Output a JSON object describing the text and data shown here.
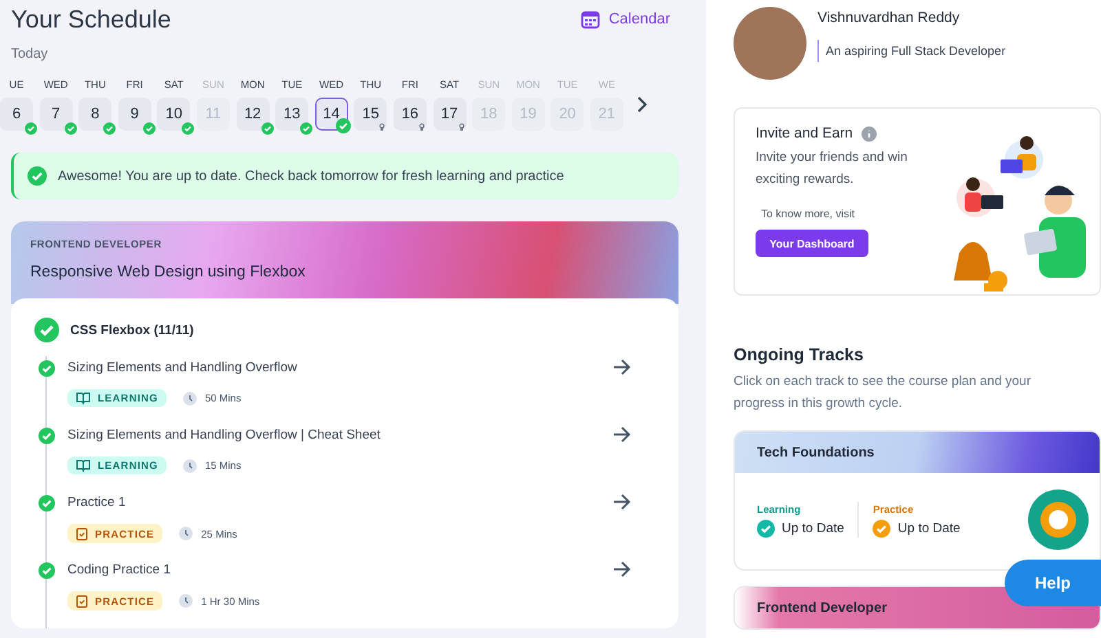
{
  "schedule": {
    "title": "Your Schedule",
    "calendar_link": "Calendar",
    "today_label": "Today",
    "days": [
      {
        "day": "UE",
        "date": "6",
        "completed": true,
        "locked": false,
        "disabled": false,
        "selected": false
      },
      {
        "day": "WED",
        "date": "7",
        "completed": true,
        "locked": false,
        "disabled": false,
        "selected": false
      },
      {
        "day": "THU",
        "date": "8",
        "completed": true,
        "locked": false,
        "disabled": false,
        "selected": false
      },
      {
        "day": "FRI",
        "date": "9",
        "completed": true,
        "locked": false,
        "disabled": false,
        "selected": false
      },
      {
        "day": "SAT",
        "date": "10",
        "completed": true,
        "locked": false,
        "disabled": false,
        "selected": false
      },
      {
        "day": "SUN",
        "date": "11",
        "completed": false,
        "locked": false,
        "disabled": true,
        "selected": false
      },
      {
        "day": "MON",
        "date": "12",
        "completed": true,
        "locked": false,
        "disabled": false,
        "selected": false
      },
      {
        "day": "TUE",
        "date": "13",
        "completed": true,
        "locked": false,
        "disabled": false,
        "selected": false
      },
      {
        "day": "WED",
        "date": "14",
        "completed": true,
        "locked": false,
        "disabled": false,
        "selected": true
      },
      {
        "day": "THU",
        "date": "15",
        "completed": false,
        "locked": true,
        "disabled": false,
        "selected": false
      },
      {
        "day": "FRI",
        "date": "16",
        "completed": false,
        "locked": true,
        "disabled": false,
        "selected": false
      },
      {
        "day": "SAT",
        "date": "17",
        "completed": false,
        "locked": true,
        "disabled": false,
        "selected": false
      },
      {
        "day": "SUN",
        "date": "18",
        "completed": false,
        "locked": false,
        "disabled": true,
        "selected": false
      },
      {
        "day": "MON",
        "date": "19",
        "completed": false,
        "locked": false,
        "disabled": true,
        "selected": false
      },
      {
        "day": "TUE",
        "date": "20",
        "completed": false,
        "locked": false,
        "disabled": true,
        "selected": false
      },
      {
        "day": "WE",
        "date": "21",
        "completed": false,
        "locked": false,
        "disabled": true,
        "selected": false
      }
    ],
    "banner": "Awesome! You are up to date. Check back tomorrow for fresh learning and practice"
  },
  "course": {
    "track": "FRONTEND DEVELOPER",
    "title": "Responsive Web Design using Flexbox",
    "topic": "CSS Flexbox (11/11)",
    "topic_done": true,
    "lessons": [
      {
        "title": "Sizing Elements and Handling Overflow",
        "kind": "learning",
        "tag": "LEARNING",
        "duration": "50 Mins",
        "done": true
      },
      {
        "title": "Sizing Elements and Handling Overflow | Cheat Sheet",
        "kind": "learning",
        "tag": "LEARNING",
        "duration": "15 Mins",
        "done": true
      },
      {
        "title": "Practice 1",
        "kind": "practice",
        "tag": "PRACTICE",
        "duration": "25 Mins",
        "done": true
      },
      {
        "title": "Coding Practice 1",
        "kind": "practice",
        "tag": "PRACTICE",
        "duration": "1 Hr 30 Mins",
        "done": true
      }
    ]
  },
  "profile": {
    "name": "Vishnuvardhan Reddy",
    "tagline": "An aspiring Full Stack Developer"
  },
  "invite": {
    "title": "Invite and Earn",
    "text": "Invite your friends and win exciting rewards.",
    "hint": "To know more, visit",
    "button": "Your Dashboard"
  },
  "tracks": {
    "title": "Ongoing Tracks",
    "description": "Click on each track to see the course plan and your progress in this growth cycle.",
    "items": [
      {
        "name": "Tech Foundations",
        "kind": "blue",
        "learning_label": "Learning",
        "learning_status": "Up to Date",
        "practice_label": "Practice",
        "practice_status": "Up to Date"
      },
      {
        "name": "Frontend Developer",
        "kind": "pink"
      }
    ]
  },
  "help_button": "Help"
}
